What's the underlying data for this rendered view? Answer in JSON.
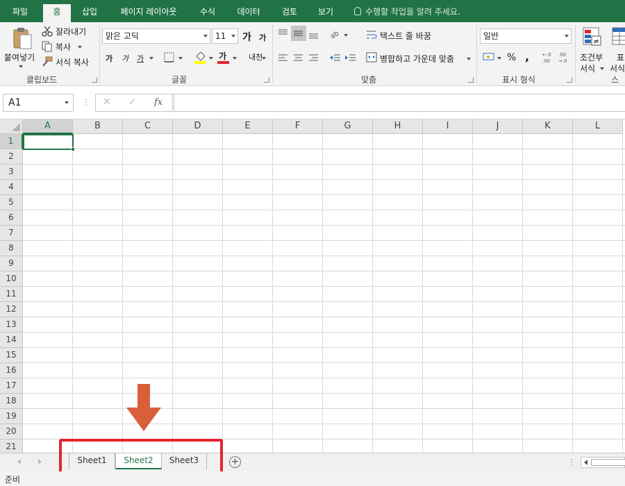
{
  "ribbon_tabs": [
    {
      "label": "파일"
    },
    {
      "label": "홈"
    },
    {
      "label": "삽입"
    },
    {
      "label": "페이지 레이아웃"
    },
    {
      "label": "수식"
    },
    {
      "label": "데이터"
    },
    {
      "label": "검토"
    },
    {
      "label": "보기"
    }
  ],
  "active_tab": "홈",
  "tell_me": "수행할 작업을 알려 주세요.",
  "clipboard": {
    "paste": "붙여넣기",
    "cut": "잘라내기",
    "copy": "복사",
    "format_painter": "서식 복사",
    "group_label": "클립보드"
  },
  "font": {
    "name": "맑은 고딕",
    "size": "11",
    "group_label": "글꼴",
    "bold": "가",
    "italic": "가",
    "underline": "가",
    "grow": "가",
    "shrink": "가",
    "font_color_glyph": "가",
    "phonetic": "내천",
    "highlight_color": "#ffff00",
    "font_color": "#e3262e"
  },
  "alignment": {
    "wrap_text": "텍스트 줄 바꿈",
    "merge_center": "병합하고 가운데 맞춤",
    "group_label": "맞춤"
  },
  "number": {
    "format": "일반",
    "percent": "%",
    "comma": ",",
    "group_label": "표시 형식"
  },
  "styles": {
    "conditional_line1": "조건부",
    "conditional_line2": "서식",
    "table_line1": "표",
    "table_line2": "서식",
    "group_label_partial": "스타"
  },
  "formula_bar": {
    "name_box": "A1",
    "cancel": "✕",
    "enter": "✓",
    "fx": "fx",
    "formula": ""
  },
  "columns": [
    "A",
    "B",
    "C",
    "D",
    "E",
    "F",
    "G",
    "H",
    "I",
    "J",
    "K",
    "L"
  ],
  "rows": [
    "1",
    "2",
    "3",
    "4",
    "5",
    "6",
    "7",
    "8",
    "9",
    "10",
    "11",
    "12",
    "13",
    "14",
    "15",
    "16",
    "17",
    "18",
    "19",
    "20",
    "21"
  ],
  "selected_cell": "A1",
  "sheets": [
    {
      "label": "Sheet1"
    },
    {
      "label": "Sheet2"
    },
    {
      "label": "Sheet3"
    }
  ],
  "active_sheet": "Sheet2",
  "add_sheet": "+",
  "status": "준비",
  "colors": {
    "brand": "#217346",
    "annotation_red": "#e3262e",
    "annotation_arrow": "#d95f3b"
  }
}
